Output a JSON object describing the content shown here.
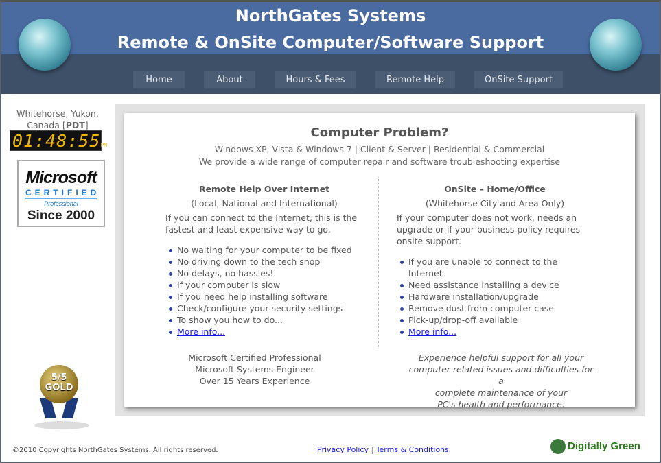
{
  "header": {
    "title": "NorthGates Systems",
    "subtitle": "Remote & OnSite Computer/Software Support",
    "colors": {
      "top": "#4a6ba0",
      "nav": "#3d5068"
    }
  },
  "nav": [
    {
      "label": "Home"
    },
    {
      "label": "About"
    },
    {
      "label": "Hours & Fees"
    },
    {
      "label": "Remote Help"
    },
    {
      "label": "OnSite Support"
    }
  ],
  "sidebar": {
    "location": "Whitehorse, Yukon,",
    "location2": "Canada [",
    "tz": "PDT",
    "tz_close": "]",
    "clock": "01:48:55",
    "ampm": "PM",
    "badge": {
      "logo": "Microsoft",
      "certified": "CERTIFIED",
      "professional": "Professional",
      "since": "Since 2000"
    },
    "medal": {
      "rating": "5/5",
      "label": "GOLD"
    }
  },
  "main": {
    "heading": "Computer Problem?",
    "line1": "Windows XP, Vista & Windows 7 | Client & Server | Residential & Commercial",
    "line2": "We provide a wide range of computer repair and software troubleshooting expertise",
    "remote": {
      "title": "Remote Help Over Internet",
      "scope": "(Local, National and International)",
      "intro": "If you can connect to the Internet, this is the fastest and least expensive way to go.",
      "items": [
        "No waiting for your computer to be fixed",
        "No driving down to the tech shop",
        "No delays, no hassles!",
        "If your computer is slow",
        "If you need help installing software",
        "Check/configure your security settings",
        "To show you how to do..."
      ],
      "more": "More info..."
    },
    "onsite": {
      "title": "OnSite – Home/Office",
      "scope": "(Whitehorse City and Area Only)",
      "intro": "If your computer does not work, needs an upgrade or if your business policy requires onsite support.",
      "items": [
        "If you are unable to connect to the Internet",
        "Need assistance installing a device",
        "Hardware installation/upgrade",
        "Remove dust from computer case",
        "Pick-up/drop-off available"
      ],
      "more": "More info..."
    },
    "creds": [
      "Microsoft Certified Professional",
      "Microsoft Systems Engineer",
      "Over 15 Years Experience"
    ],
    "tagline": [
      "Experience helpful support for all your",
      "computer related issues and difficulties for a",
      "complete maintenance of your",
      "PC's health and performance."
    ]
  },
  "footer": {
    "copyright": "©2010 Copyrights NorthGates Systems. All rights reserved.",
    "privacy": "Privacy Policy",
    "sep": "|",
    "terms": "Terms & Conditions",
    "logo": "Digitally Green"
  }
}
